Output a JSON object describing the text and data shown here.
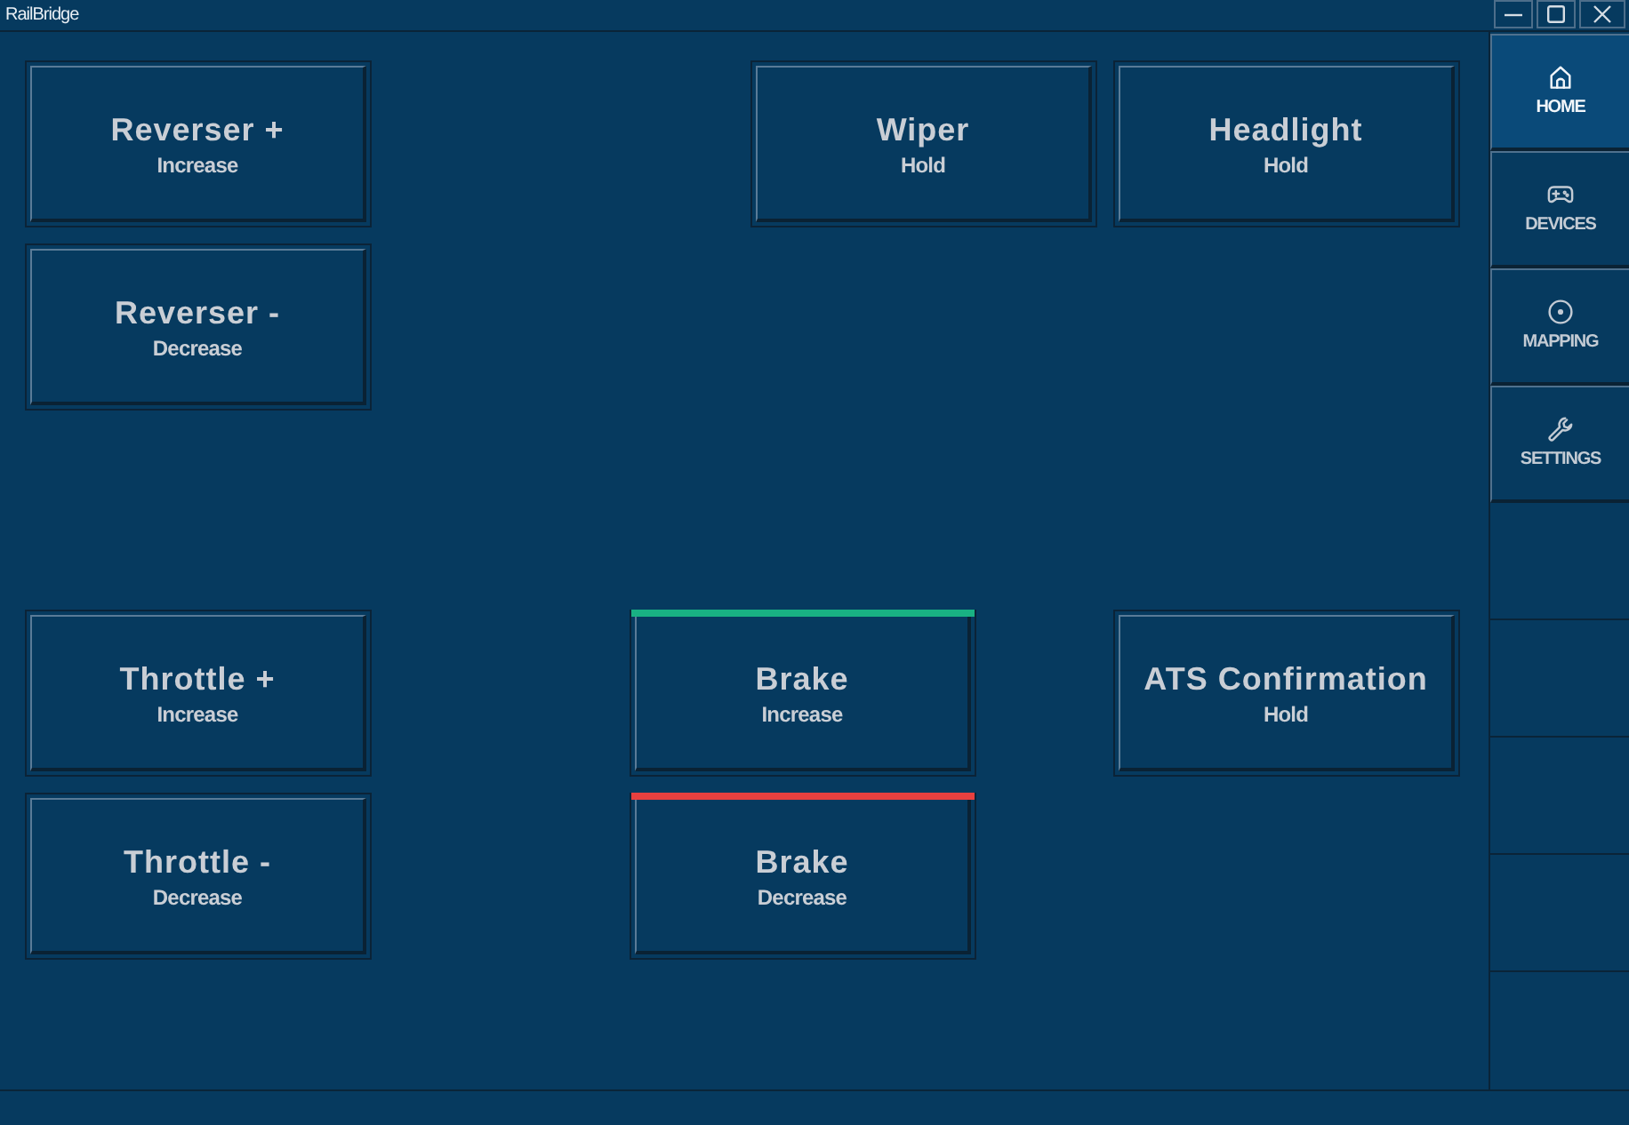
{
  "window": {
    "title": "RailBridge"
  },
  "buttons": [
    {
      "title": "Reverser +",
      "action": "Increase"
    },
    {
      "title": "Wiper",
      "action": "Hold"
    },
    {
      "title": "Headlight",
      "action": "Hold"
    },
    {
      "title": "Reverser -",
      "action": "Decrease"
    },
    {
      "title": "Throttle +",
      "action": "Increase"
    },
    {
      "title": "Brake",
      "action": "Increase",
      "color": "#19b183"
    },
    {
      "title": "ATS Confirmation",
      "action": "Hold"
    },
    {
      "title": "Throttle -",
      "action": "Decrease"
    },
    {
      "title": "Brake",
      "action": "Decrease",
      "color": "#e7403f"
    }
  ],
  "sidebar": {
    "items": [
      {
        "label": "HOME",
        "selected": true
      },
      {
        "label": "DEVICES",
        "selected": false
      },
      {
        "label": "MAPPING",
        "selected": false
      },
      {
        "label": "SETTINGS",
        "selected": false
      }
    ]
  }
}
